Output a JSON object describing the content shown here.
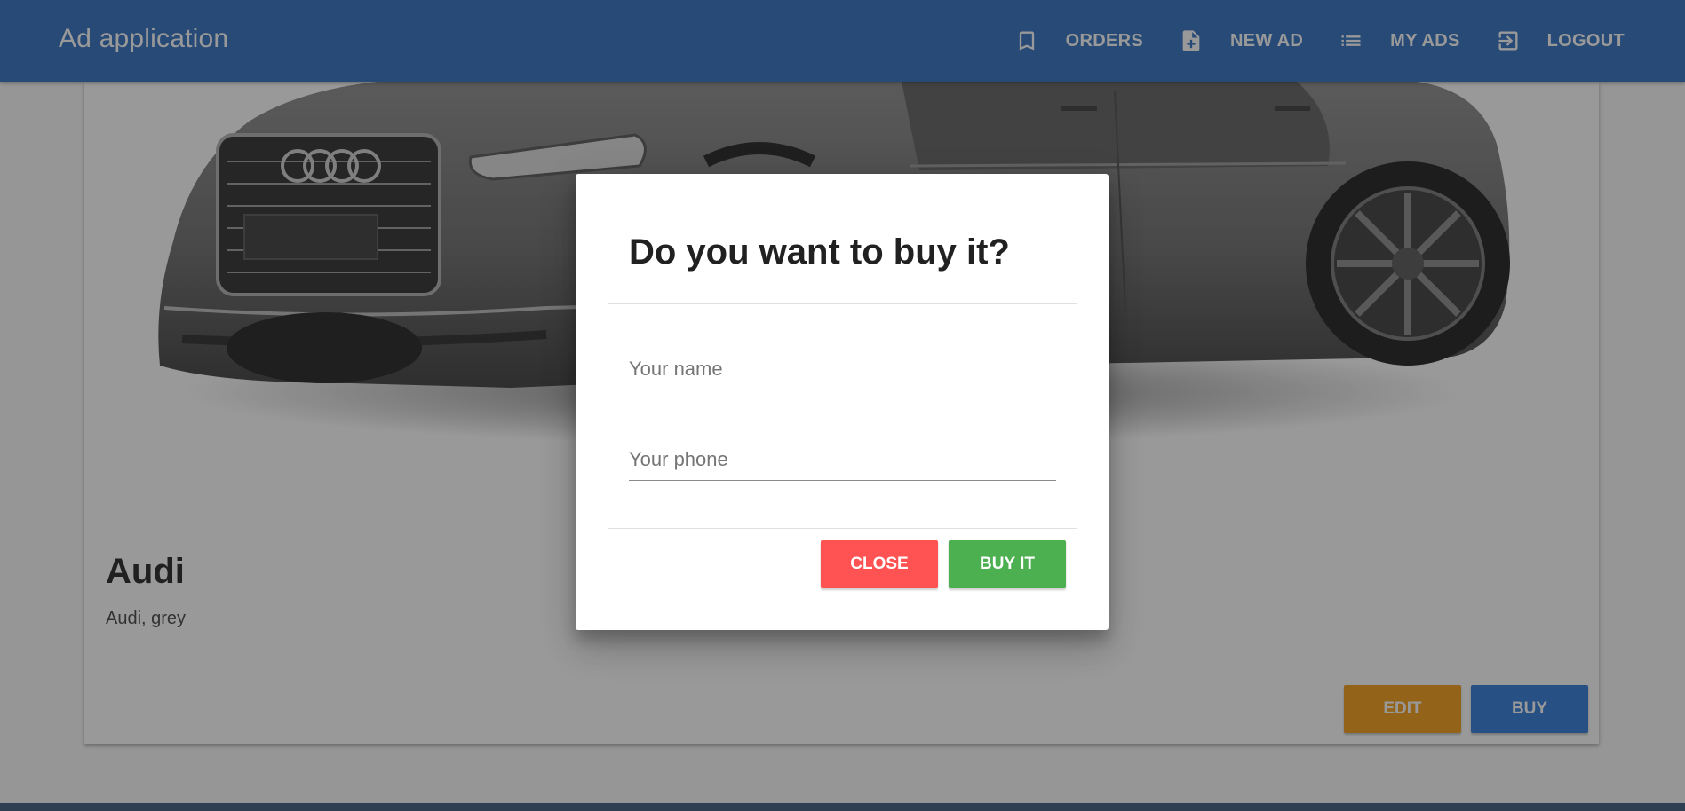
{
  "toolbar": {
    "title": "Ad application",
    "nav": [
      {
        "label": "ORDERS",
        "icon": "bookmark-icon"
      },
      {
        "label": "NEW AD",
        "icon": "note-add-icon"
      },
      {
        "label": "MY ADS",
        "icon": "list-icon"
      },
      {
        "label": "LOGOUT",
        "icon": "exit-icon"
      }
    ]
  },
  "ad": {
    "title": "Audi",
    "description": "Audi, grey",
    "edit_label": "EDIT",
    "buy_label": "BUY"
  },
  "dialog": {
    "title": "Do you want to buy it?",
    "name_placeholder": "Your name",
    "name_value": "",
    "phone_placeholder": "Your phone",
    "phone_value": "",
    "close_label": "CLOSE",
    "buy_label": "BUY IT"
  },
  "colors": {
    "toolbar": "#2d6dc1",
    "edit": "#f39c12",
    "buy": "#2d79d8",
    "close": "#ff5252",
    "buy_it": "#4caf50"
  }
}
